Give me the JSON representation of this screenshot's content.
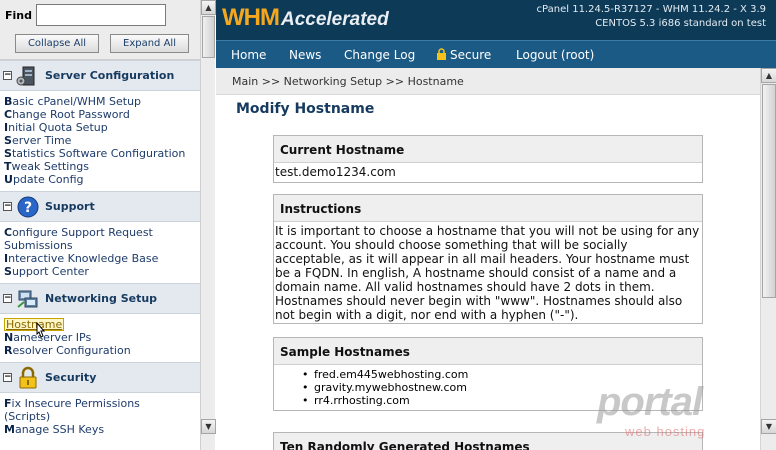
{
  "sidebar": {
    "find_label": "Find",
    "find_value": "",
    "collapse_label": "Collapse All",
    "expand_label": "Expand All",
    "categories": [
      {
        "title": "Server Configuration",
        "icon": "server-icon",
        "links": [
          {
            "first": "B",
            "rest": "asic cPanel/WHM Setup"
          },
          {
            "first": "C",
            "rest": "hange Root Password"
          },
          {
            "first": "I",
            "rest": "nitial Quota Setup"
          },
          {
            "first": "S",
            "rest": "erver Time"
          },
          {
            "first": "S",
            "rest": "tatistics Software Configuration"
          },
          {
            "first": "T",
            "rest": "weak Settings"
          },
          {
            "first": "U",
            "rest": "pdate Config"
          }
        ]
      },
      {
        "title": "Support",
        "icon": "help-icon",
        "links": [
          {
            "first": "C",
            "rest": "onfigure Support Request"
          },
          {
            "first": "",
            "rest": "Submissions"
          },
          {
            "first": "I",
            "rest": "nteractive Knowledge Base"
          },
          {
            "first": "S",
            "rest": "upport Center"
          }
        ]
      },
      {
        "title": "Networking Setup",
        "icon": "network-icon",
        "links": [
          {
            "first": "",
            "rest": "Hostname"
          },
          {
            "first": "N",
            "rest": "ameserver IPs"
          },
          {
            "first": "R",
            "rest": "esolver Configuration"
          }
        ]
      },
      {
        "title": "Security",
        "icon": "lock-icon",
        "links": [
          {
            "first": "F",
            "rest": "ix Insecure Permissions"
          },
          {
            "first": "",
            "rest": "(Scripts)"
          },
          {
            "first": "M",
            "rest": "anage SSH Keys"
          }
        ]
      }
    ]
  },
  "header": {
    "logo_whm": "WHM",
    "logo_accelerated": "Accelerated",
    "version_line1": "cPanel 11.24.5-R37127 - WHM 11.24.2 - X 3.9",
    "version_line2": "CENTOS 5.3 i686 standard on test"
  },
  "nav": {
    "home": "Home",
    "news": "News",
    "changelog": "Change Log",
    "secure": "Secure",
    "logout": "Logout (root)"
  },
  "breadcrumb": "Main >> Networking Setup >> Hostname",
  "main": {
    "title": "Modify Hostname",
    "current_heading": "Current Hostname",
    "current_value": "test.demo1234.com",
    "instructions_heading": "Instructions",
    "instructions_text": "It is important to choose a hostname that you will not be using for any account. You should choose something that will be socially acceptable, as it will appear in all mail headers. Your hostname must be a FQDN. In english, A hostname should consist of a name and a domain name. All valid hostnames should have 2 dots in them. Hostnames should never begin with \"www\". Hostnames should also not begin with a digit, nor end with a hyphen (\"-\").",
    "samples_heading": "Sample Hostnames",
    "samples": [
      "fred.em445webhosting.com",
      "gravity.mywebhostnew.com",
      "rr4.rrhosting.com"
    ],
    "random_heading": "Ten Randomly Generated Hostnames"
  },
  "watermark": {
    "brand": "portal",
    "sub": "web hosting"
  },
  "colors": {
    "banner": "#0d3a57",
    "nav": "#1c5a86",
    "logo_accent": "#f5a81e",
    "link": "#1f3c6b"
  }
}
